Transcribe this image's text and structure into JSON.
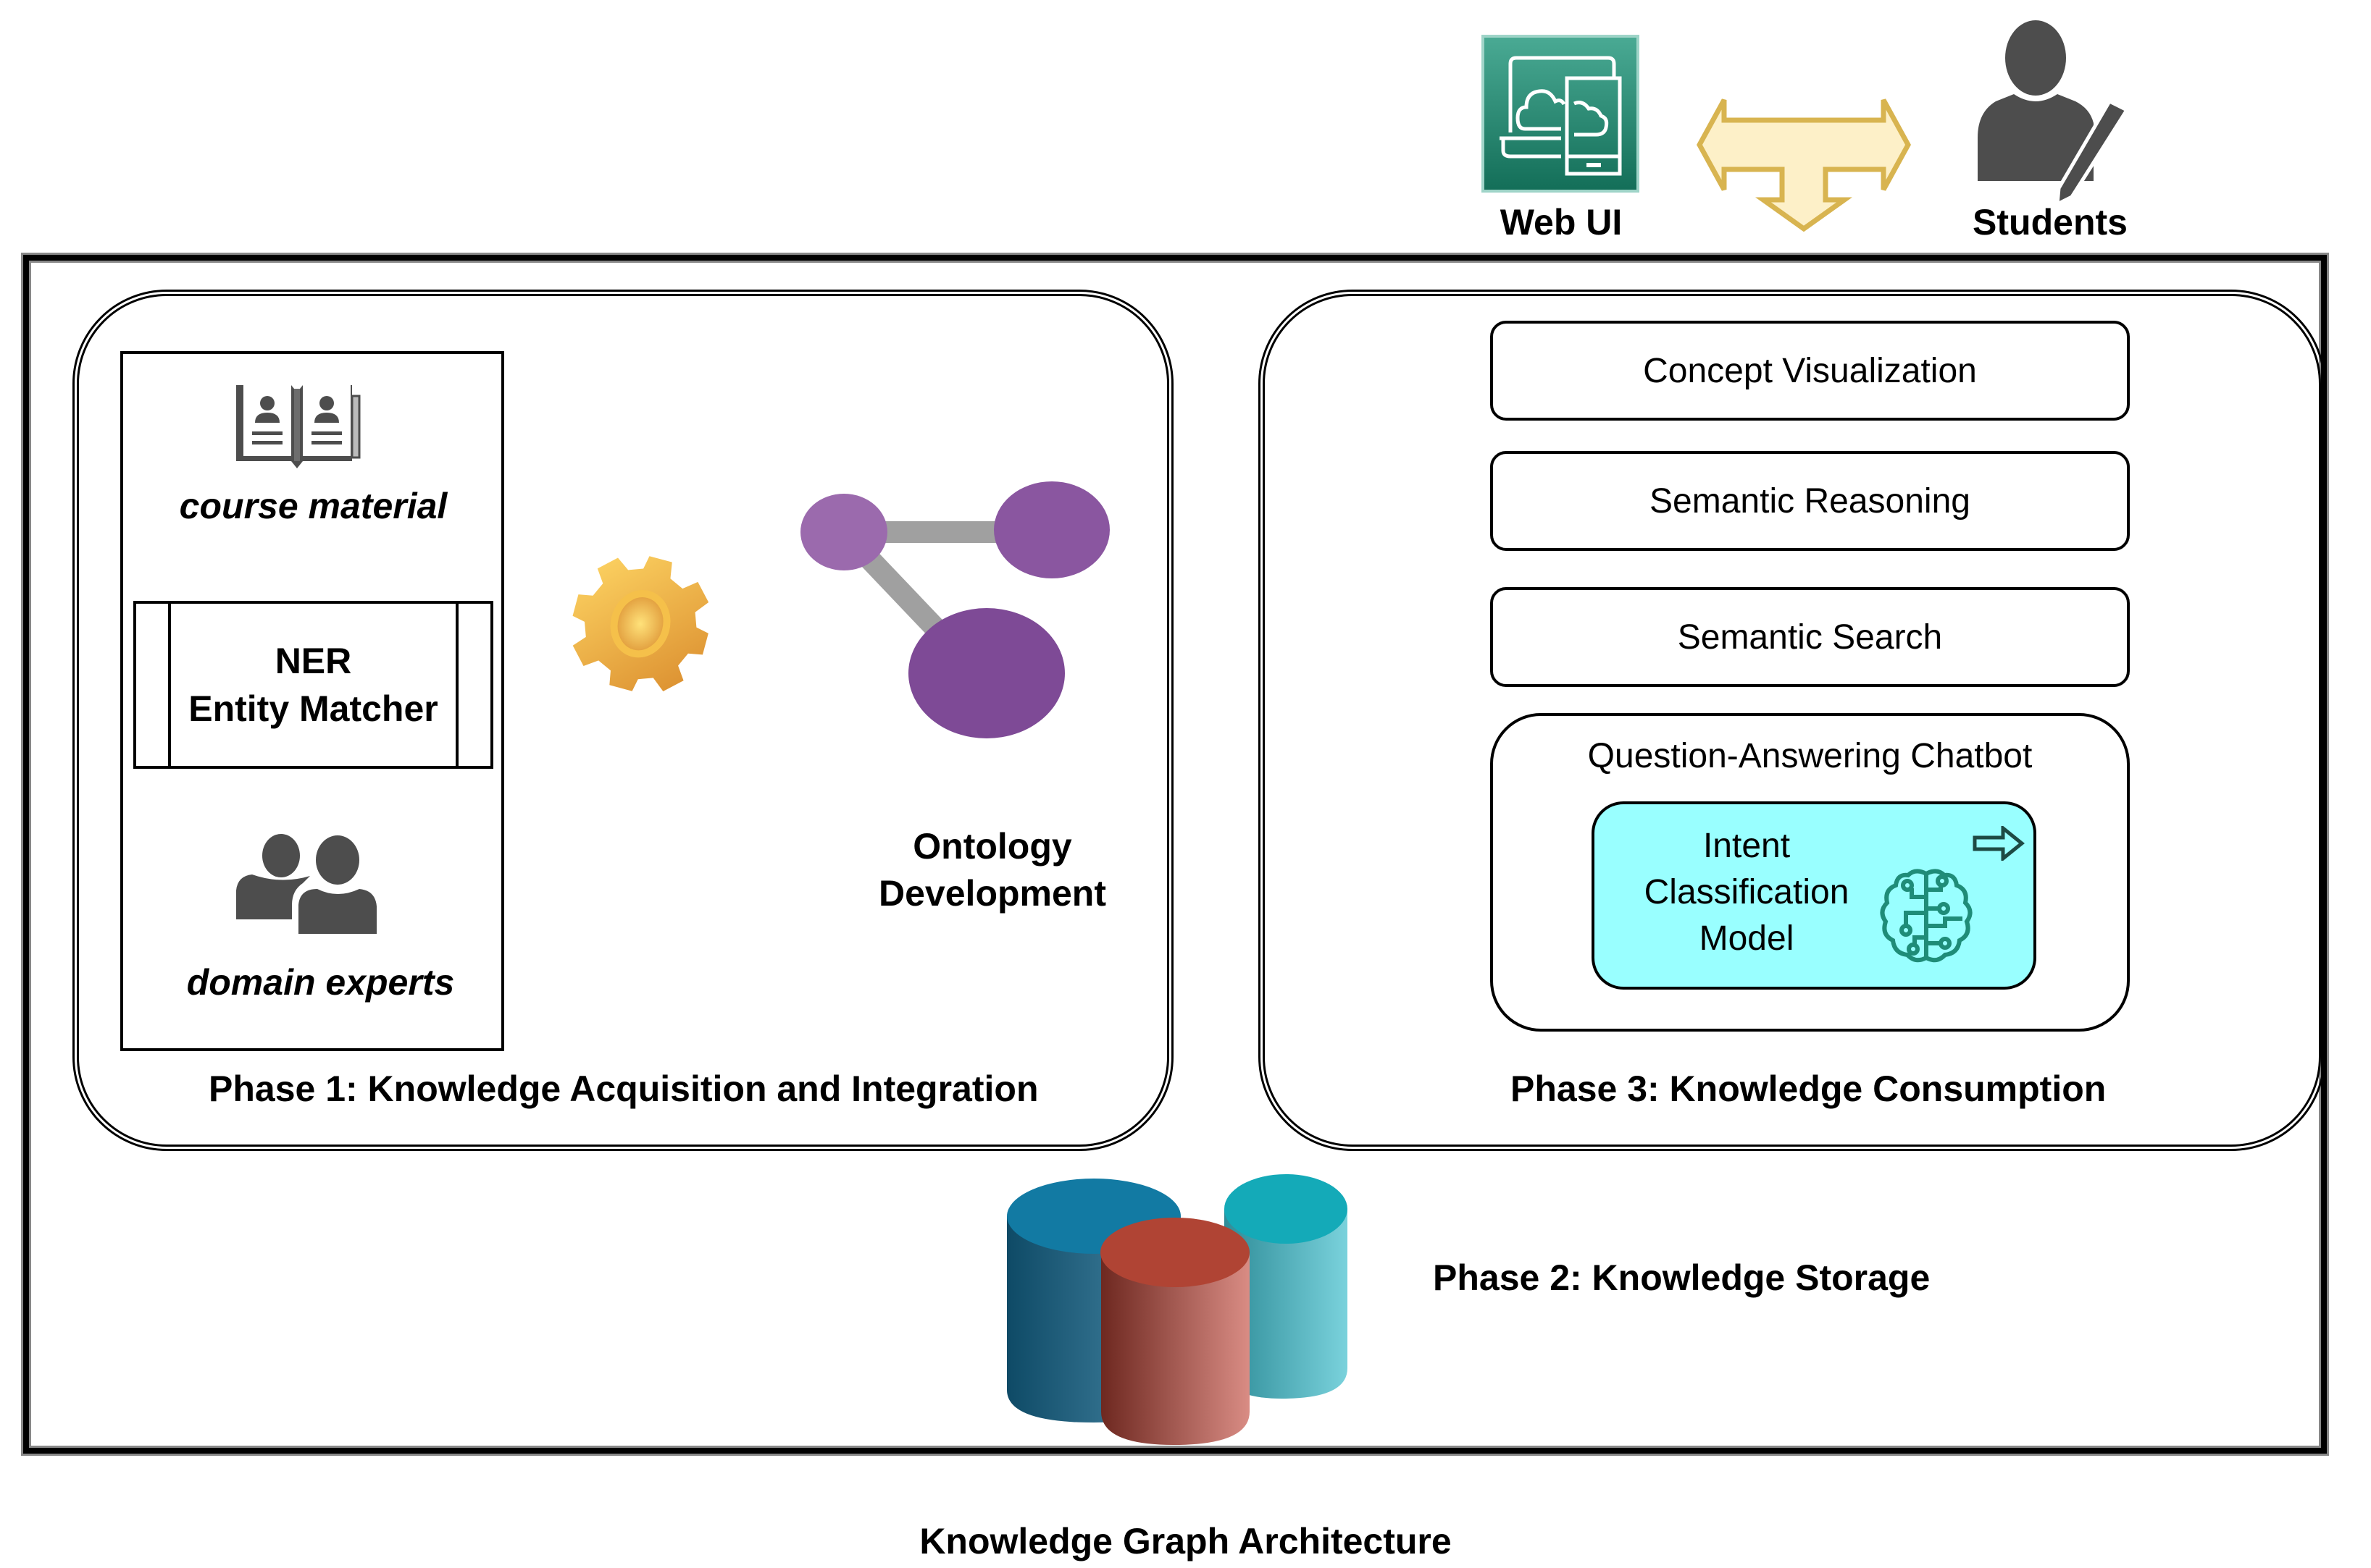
{
  "caption": "Knowledge Graph Architecture",
  "top": {
    "web_ui": {
      "label": "Web UI",
      "icon": "web-mobile-cloud-icon",
      "color": "#2a8c74"
    },
    "arrow": {
      "icon": "three-way-arrow-icon",
      "fill": "#fdf0c8",
      "stroke": "#d8b450"
    },
    "students": {
      "label": "Students",
      "icon": "student-writing-icon",
      "color": "#4d4d4d"
    }
  },
  "phase1": {
    "title": "Phase 1: Knowledge Acquisition and Integration",
    "sources": [
      {
        "label": "course material",
        "icon": "open-book-icon"
      },
      {
        "label": "domain experts",
        "icon": "people-icon"
      }
    ],
    "ner": {
      "line1": "NER",
      "line2": "Entity Matcher"
    },
    "gear": {
      "icon": "gear-icon"
    },
    "ontology": {
      "line1": "Ontology",
      "line2": "Development",
      "icon": "graph-nodes-icon",
      "node_color": "#7e4a96",
      "edge_color": "#a0a0a0"
    }
  },
  "phase2": {
    "title": "Phase 2: Knowledge Storage",
    "icon": "database-cylinders-icon",
    "colors": {
      "blue": "#127aa3",
      "teal": "#14aab8",
      "red": "#b04434"
    }
  },
  "phase3": {
    "title": "Phase 3: Knowledge Consumption",
    "services": [
      "Concept Visualization",
      "Semantic Reasoning",
      "Semantic Search"
    ],
    "chatbot": {
      "title": "Question-Answering Chatbot",
      "model": {
        "line1": "Intent",
        "line2": "Classification",
        "line3": "Model",
        "bg": "#99ffff",
        "icon": "ai-brain-icon",
        "arrow_icon": "arrow-right-icon"
      }
    }
  }
}
